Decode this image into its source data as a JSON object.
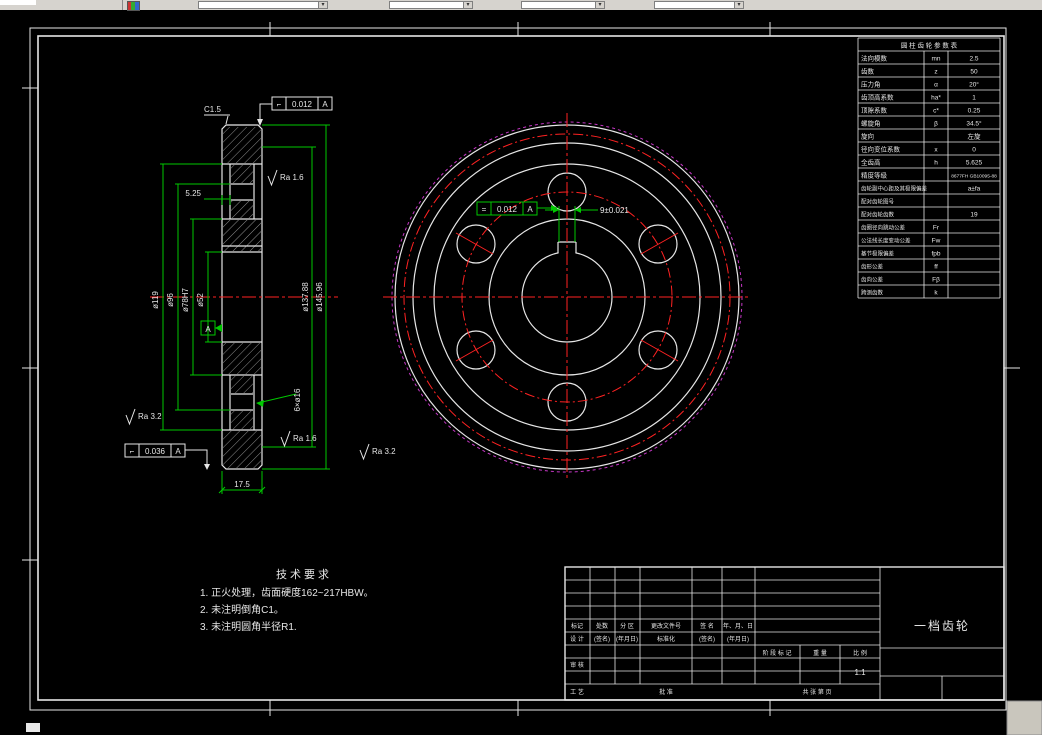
{
  "toolbar": {
    "combo1": "",
    "combo2": "",
    "combo3": "",
    "combo4": ""
  },
  "colors": {
    "line": "#e6e6e6",
    "dimension": "#00c800",
    "centerline": "#ff2222",
    "auxiliary": "#c436c4"
  },
  "section_view": {
    "chamfer": "C1.5",
    "dim_top": "5.25",
    "dim_bottom": "17.5",
    "holes": "6×ø16",
    "dims": {
      "d1": "ø119",
      "d2": "ø96",
      "d3": "ø78H7",
      "d4": "ø52",
      "d5": "ø137.88",
      "d6": "ø145.96"
    },
    "ra1": "Ra 1.6",
    "ra2": "Ra 1.6",
    "ra3": "Ra 3.2",
    "ra4": "Ra 3.2",
    "tol_top": {
      "sym": "⌐",
      "val": "0.012",
      "datum": "A"
    },
    "tol_bottom": {
      "sym": "⌐",
      "val": "0.036",
      "datum": "A"
    },
    "datum": "A"
  },
  "front_view": {
    "key_width": "9±0.021",
    "tol_key": {
      "sym": "=",
      "val": "0.012",
      "datum": "A"
    }
  },
  "tech_req": {
    "title": "技术要求",
    "line1": "1. 正火处理，齿面硬度162~217HBW。",
    "line2": "2. 未注明倒角C1。",
    "line3": "3. 未注明圆角半径R1."
  },
  "param_table": {
    "title": "圆 柱 齿 轮 参 数 表",
    "rows": [
      {
        "label": "法向模数",
        "sym": "mn",
        "val": "2.5"
      },
      {
        "label": "齿数",
        "sym": "z",
        "val": "50"
      },
      {
        "label": "压力角",
        "sym": "α",
        "val": "20°"
      },
      {
        "label": "齿顶高系数",
        "sym": "ha*",
        "val": "1"
      },
      {
        "label": "顶隙系数",
        "sym": "c*",
        "val": "0.25"
      },
      {
        "label": "螺旋角",
        "sym": "β",
        "val": "34.5°"
      },
      {
        "label": "旋向",
        "sym": "",
        "val": "左旋"
      },
      {
        "label": "径向变位系数",
        "sym": "x",
        "val": "0"
      },
      {
        "label": "全齿高",
        "sym": "h",
        "val": "5.625"
      },
      {
        "label": "精度等级",
        "sym": "",
        "val": "8677FH GB10095-88"
      },
      {
        "label": "齿轮副中心距及其极限偏差",
        "sym": "",
        "val": "a±fa"
      },
      {
        "label": "配对齿轮图号",
        "sym": "",
        "val": ""
      },
      {
        "label": "配对齿轮齿数",
        "sym": "",
        "val": "19"
      },
      {
        "label": "齿圈径向跳动公差",
        "sym": "Fr",
        "val": ""
      },
      {
        "label": "公法线长度变动公差",
        "sym": "Fw",
        "val": ""
      },
      {
        "label": "基节极限偏差",
        "sym": "fpb",
        "val": ""
      },
      {
        "label": "齿形公差",
        "sym": "ff",
        "val": ""
      },
      {
        "label": "齿向公差",
        "sym": "Fβ",
        "val": ""
      },
      {
        "label": "跨测齿数",
        "sym": "k",
        "val": ""
      }
    ]
  },
  "title_block": {
    "r1c1": "标记",
    "r1c2": "处数",
    "r1c3": "分 区",
    "r1c4": "更改文件号",
    "r1c5": "签 名",
    "r1c6": "年、月、日",
    "r2c1": "设 计",
    "r2c2": "(签名)",
    "r2c3": "(年月日)",
    "r2c4": "标准化",
    "r2c5": "(签名)",
    "r2c6": "(年月日)",
    "stage": "阶 段 标 记",
    "weight": "重 量",
    "scale_label": "比 例",
    "scale": "1:1",
    "review": "审 核",
    "process": "工 艺",
    "approve": "批 准",
    "sheets": "共  张  第  页",
    "part_name": "一档齿轮"
  }
}
